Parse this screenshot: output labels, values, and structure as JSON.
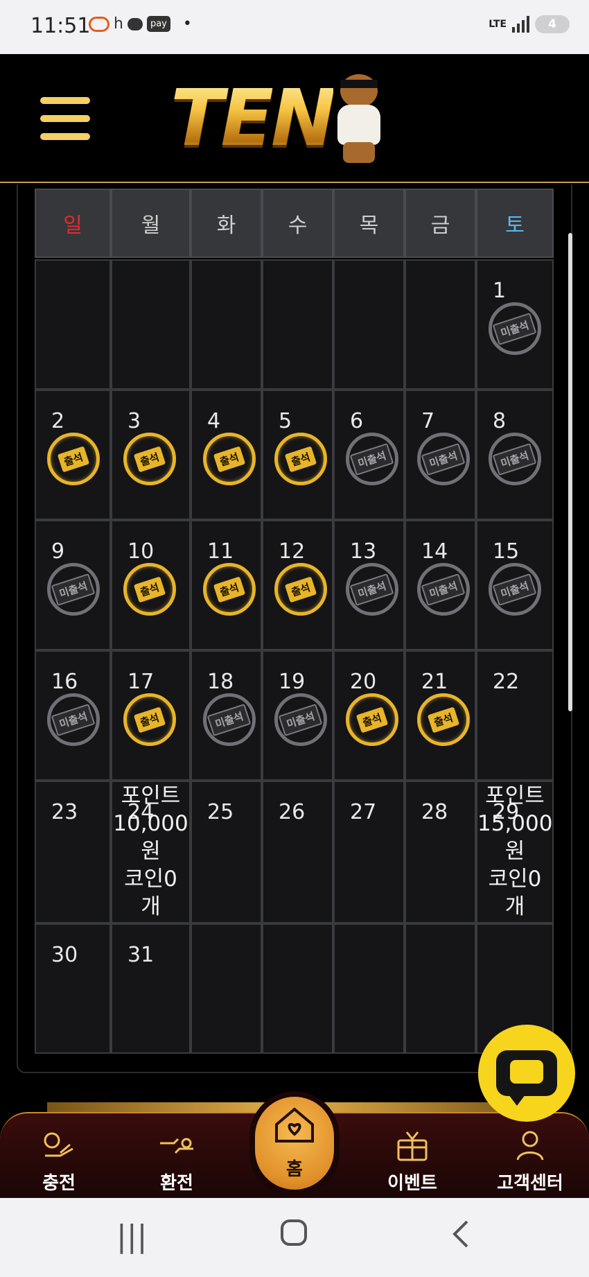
{
  "status": {
    "time": "11:51",
    "h_text": "h",
    "pay_text": "pay",
    "dot": "•",
    "lte": "LTE",
    "battery": "4"
  },
  "header": {
    "logo_text": "TEN",
    "bear_band_text": "TEN"
  },
  "calendar": {
    "weekdays": [
      "일",
      "월",
      "화",
      "수",
      "목",
      "금",
      "토"
    ],
    "weekday_colors": {
      "sun": "#e52b2b",
      "sat": "#5bb8f2",
      "default": "#cfcfcf"
    },
    "stamp_on_label": "출석",
    "stamp_off_label": "미출석",
    "weeks": [
      [
        {
          "day": ""
        },
        {
          "day": ""
        },
        {
          "day": ""
        },
        {
          "day": ""
        },
        {
          "day": ""
        },
        {
          "day": ""
        },
        {
          "day": "1",
          "stamp": "off"
        }
      ],
      [
        {
          "day": "2",
          "stamp": "on"
        },
        {
          "day": "3",
          "stamp": "on"
        },
        {
          "day": "4",
          "stamp": "on"
        },
        {
          "day": "5",
          "stamp": "on"
        },
        {
          "day": "6",
          "stamp": "off"
        },
        {
          "day": "7",
          "stamp": "off"
        },
        {
          "day": "8",
          "stamp": "off"
        }
      ],
      [
        {
          "day": "9",
          "stamp": "off"
        },
        {
          "day": "10",
          "stamp": "on"
        },
        {
          "day": "11",
          "stamp": "on"
        },
        {
          "day": "12",
          "stamp": "on"
        },
        {
          "day": "13",
          "stamp": "off"
        },
        {
          "day": "14",
          "stamp": "off"
        },
        {
          "day": "15",
          "stamp": "off"
        }
      ],
      [
        {
          "day": "16",
          "stamp": "off"
        },
        {
          "day": "17",
          "stamp": "on"
        },
        {
          "day": "18",
          "stamp": "off"
        },
        {
          "day": "19",
          "stamp": "off"
        },
        {
          "day": "20",
          "stamp": "on"
        },
        {
          "day": "21",
          "stamp": "on"
        },
        {
          "day": "22"
        }
      ],
      [
        {
          "day": "23"
        },
        {
          "day": "24",
          "reward": [
            "포인트",
            "10,000",
            "원",
            "코인0",
            "개"
          ]
        },
        {
          "day": "25"
        },
        {
          "day": "26"
        },
        {
          "day": "27"
        },
        {
          "day": "28"
        },
        {
          "day": "29",
          "reward": [
            "포인트",
            "15,000",
            "원",
            "코인0",
            "개"
          ]
        }
      ],
      [
        {
          "day": "30"
        },
        {
          "day": "31"
        },
        {
          "day": ""
        },
        {
          "day": ""
        },
        {
          "day": ""
        },
        {
          "day": ""
        },
        {
          "day": ""
        }
      ]
    ]
  },
  "bottom_nav": {
    "items": [
      {
        "label": "충전",
        "icon": "charge-icon"
      },
      {
        "label": "환전",
        "icon": "exchange-icon"
      },
      {
        "label": "홈",
        "icon": "home-icon"
      },
      {
        "label": "이벤트",
        "icon": "gift-icon"
      },
      {
        "label": "고객센터",
        "icon": "support-icon"
      }
    ]
  },
  "chat": {
    "icon": "chat-bubble-icon"
  },
  "system_nav": {
    "recent": "|||",
    "home": "○",
    "back": "<"
  }
}
